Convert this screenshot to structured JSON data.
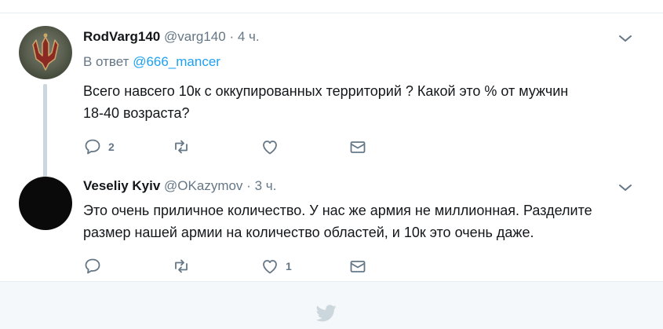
{
  "tweets": [
    {
      "fullname": "RodVarg140",
      "handle": "@varg140",
      "separator": "·",
      "time": "4 ч.",
      "reply_prefix": "В ответ",
      "reply_mention": "@666_mancer",
      "text_line1": "Всего навсего 10к с оккупированных территорий ? Какой это % от мужчин",
      "text_line2": "18-40 возраста?",
      "reply_count": "2",
      "retweet_count": "",
      "like_count": "",
      "avatar_icon": "trident-emblem-avatar"
    },
    {
      "fullname": "Veseliy Kyiv",
      "handle": "@OKazymov",
      "separator": "·",
      "time": "3 ч.",
      "text_line1": "Это очень приличное количество. У нас же армия не миллионная. Разделите",
      "text_line2": "размер нашей армии на количество областей, и 10к это очень даже.",
      "reply_count": "",
      "retweet_count": "",
      "like_count": "1",
      "avatar_icon": "black-avatar"
    }
  ],
  "icons": {
    "reply": "reply-icon",
    "retweet": "retweet-icon",
    "like": "heart-icon",
    "dm": "envelope-icon",
    "caret": "chevron-down-icon",
    "footer": "twitter-bird-icon"
  },
  "colors": {
    "accent": "#1da1f2",
    "muted": "#657786",
    "text": "#14171a",
    "border": "#e6ecf0",
    "thread_line": "#ccd6dd",
    "footer_bg": "#f5f8fa"
  }
}
